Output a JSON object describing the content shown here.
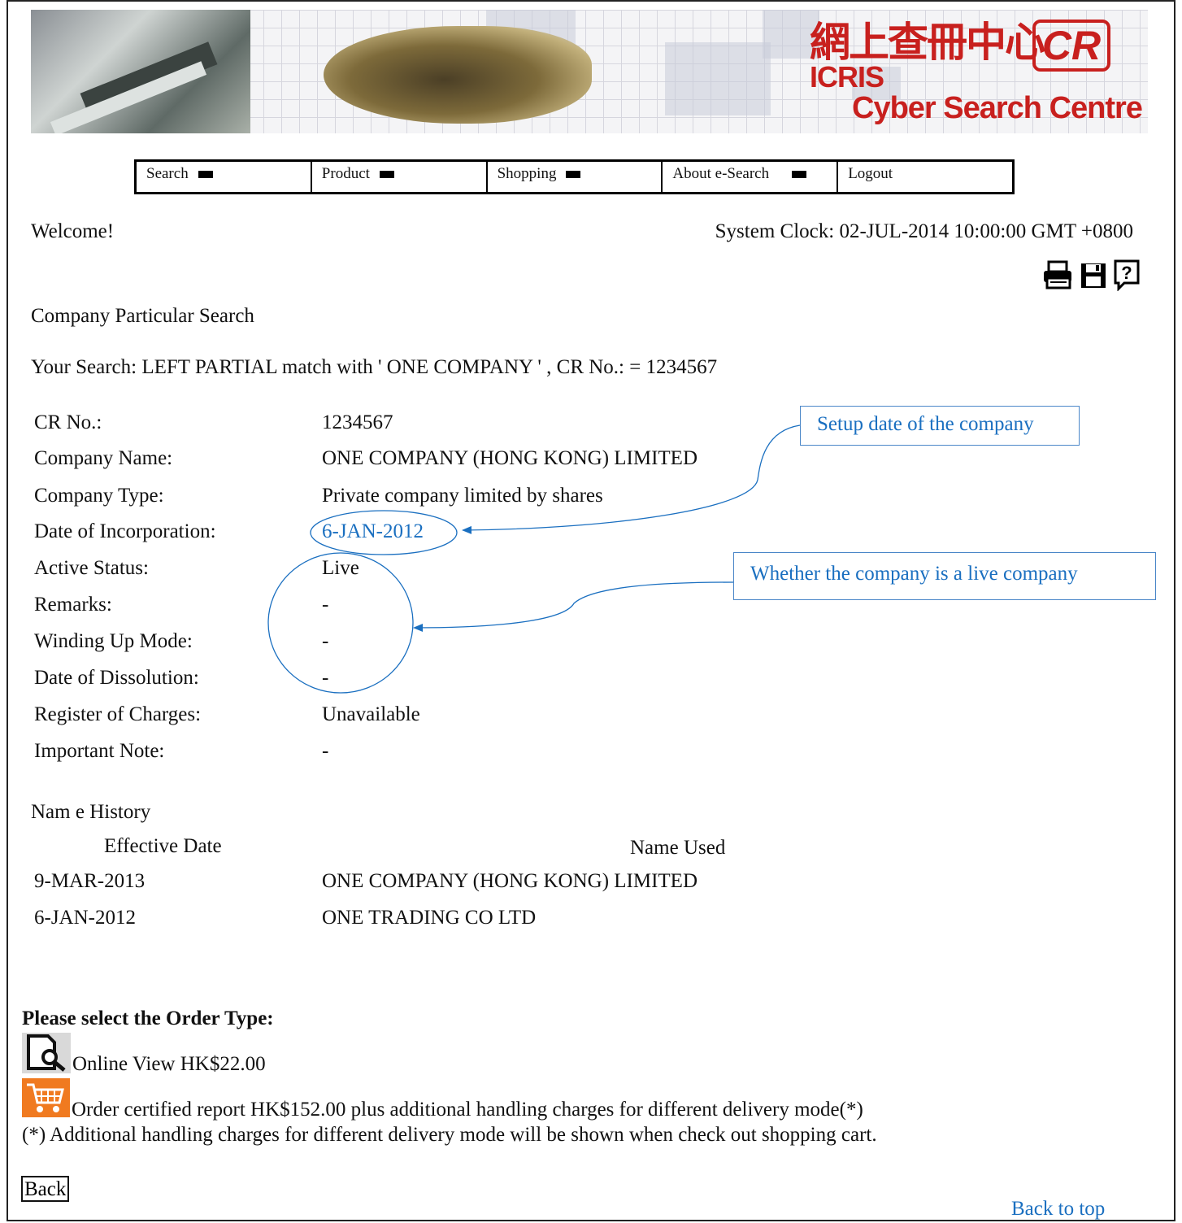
{
  "banner": {
    "title_cn": "網上查冊中心",
    "logo_text": "CR",
    "brand": "ICRIS",
    "subtitle": "Cyber Search Centre"
  },
  "menu": [
    {
      "label": "Search",
      "has_arrow": true
    },
    {
      "label": "Product",
      "has_arrow": true
    },
    {
      "label": "Shopping",
      "has_arrow": true
    },
    {
      "label": "About e-Search",
      "has_arrow": true
    },
    {
      "label": "Logout",
      "has_arrow": false
    }
  ],
  "welcome": "Welcome!",
  "system_clock": "System Clock: 02-JUL-2014 10:00:00 GMT +0800",
  "toolbar_icons": [
    "print-icon",
    "save-icon",
    "help-icon"
  ],
  "section_title": "Company Particular Search",
  "your_search": "Your Search: LEFT PARTIAL match with ' ONE COMPANY ' , CR No.: = 1234567",
  "particulars": [
    {
      "label": "CR No.:",
      "value": "1234567"
    },
    {
      "label": "Company Name:",
      "value": "ONE COMPANY (HONG KONG) LIMITED"
    },
    {
      "label": "Company Type:",
      "value": "Private company limited by shares"
    },
    {
      "label": "Date of Incorporation:",
      "value": "6-JAN-2012"
    },
    {
      "label": "Active Status:",
      "value": "Live"
    },
    {
      "label": "Remarks:",
      "value": "-"
    },
    {
      "label": "Winding Up Mode:",
      "value": "-"
    },
    {
      "label": "Date of Dissolution:",
      "value": "-"
    },
    {
      "label": "Register of Charges:",
      "value": "Unavailable"
    },
    {
      "label": "Important Note:",
      "value": "-"
    }
  ],
  "annotations": {
    "setup_date": "Setup date of the company",
    "live_company": "Whether the company is a live company"
  },
  "name_history": {
    "title": "Nam e History",
    "col_date": "Effective Date",
    "col_name": "Name Used",
    "rows": [
      {
        "date": "9-MAR-2013",
        "name": "ONE COMPANY (HONG KONG) LIMITED"
      },
      {
        "date": "6-JAN-2012",
        "name": "ONE TRADING CO LTD"
      }
    ]
  },
  "order": {
    "heading": "Please select the Order Type:",
    "online_view": "Online View HK$22.00",
    "certified": "Order certified report HK$152.00 plus additional handling charges for different delivery mode(*)",
    "note": "(*) Additional handling charges for different delivery mode will be shown when check out shopping cart."
  },
  "back_button": "Back",
  "back_to_top": "Back to top",
  "colors": {
    "annotation": "#1a6fc0",
    "banner_red": "#c8201e",
    "cart_orange": "#f07a20"
  }
}
